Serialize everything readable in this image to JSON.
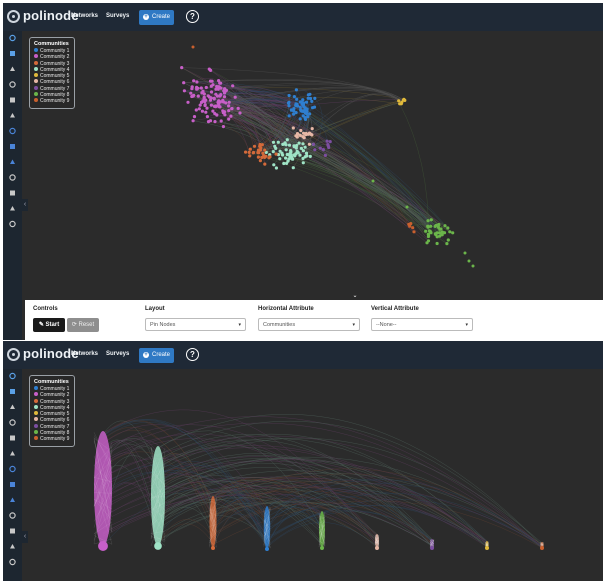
{
  "brand": "polinode",
  "nav": {
    "networks": "Networks",
    "surveys": "Surveys",
    "create": "Create",
    "help": "?"
  },
  "legend": {
    "title": "Communities",
    "items": [
      {
        "label": "Community 1",
        "color": "#2f7fd0"
      },
      {
        "label": "Community 2",
        "color": "#c75fc8"
      },
      {
        "label": "Community 3",
        "color": "#d46a3a"
      },
      {
        "label": "Community 4",
        "color": "#9fe3c6"
      },
      {
        "label": "Community 5",
        "color": "#e0b93b"
      },
      {
        "label": "Community 6",
        "color": "#e6b7a6"
      },
      {
        "label": "Community 7",
        "color": "#7c4ea0"
      },
      {
        "label": "Community 8",
        "color": "#6bb54a"
      },
      {
        "label": "Community 9",
        "color": "#c9602e"
      }
    ]
  },
  "controls": {
    "controls_label": "Controls",
    "start_label": "Start",
    "reset_label": "Reset",
    "layout_label": "Layout",
    "layout_value": "Pin Nodes",
    "horizontal_label": "Horizontal Attribute",
    "horizontal_value": "Communities",
    "vertical_label": "Vertical Attribute",
    "vertical_value": "--None--"
  },
  "sidebar_icons": [
    "pencil-icon",
    "table-icon",
    "grid-icon",
    "filter-icon",
    "circle-icon",
    "text-icon",
    "document-icon",
    "info-icon",
    "layers-icon",
    "funnel-icon",
    "sliders-icon",
    "share-icon",
    "settings-icon"
  ]
}
